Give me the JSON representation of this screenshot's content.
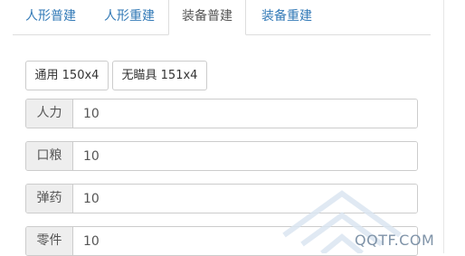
{
  "tabs": [
    {
      "label": "人形普建",
      "active": false
    },
    {
      "label": "人形重建",
      "active": false
    },
    {
      "label": "装备普建",
      "active": true
    },
    {
      "label": "装备重建",
      "active": false
    }
  ],
  "presets": [
    {
      "label": "通用 150x4"
    },
    {
      "label": "无瞄具 151x4"
    }
  ],
  "fields": [
    {
      "label": "人力",
      "value": "10"
    },
    {
      "label": "口粮",
      "value": "10"
    },
    {
      "label": "弹药",
      "value": "10"
    },
    {
      "label": "零件",
      "value": "10"
    }
  ],
  "watermark": {
    "text": "QQTF.COM",
    "color": "#7f93a8"
  },
  "colors": {
    "link": "#337ab7",
    "addon_bg": "#eeeeee",
    "border": "#cccccc"
  }
}
